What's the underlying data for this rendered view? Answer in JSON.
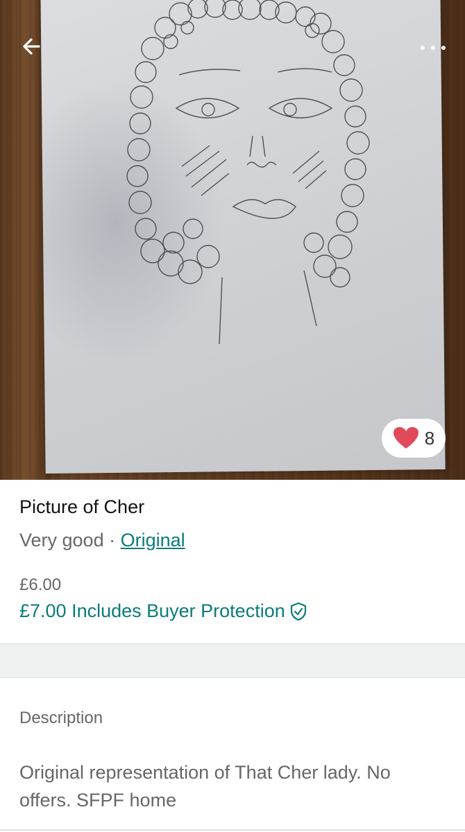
{
  "photo": {
    "favorites_count": "8",
    "icons": {
      "back": "arrow-left-icon",
      "more": "more-dots-icon",
      "favorite": "heart-icon"
    },
    "colors": {
      "heart": "#e04a5a"
    }
  },
  "item": {
    "title": "Picture of Cher",
    "condition": "Very good",
    "separator": " · ",
    "brand": "Original",
    "price": "£6.00",
    "price_with_protection": "£7.00 Includes Buyer Protection"
  },
  "description": {
    "heading": "Description",
    "text": "Original representation of That Cher lady. No offers. SFPF home"
  },
  "theme": {
    "accent": "#0a7b7b"
  }
}
